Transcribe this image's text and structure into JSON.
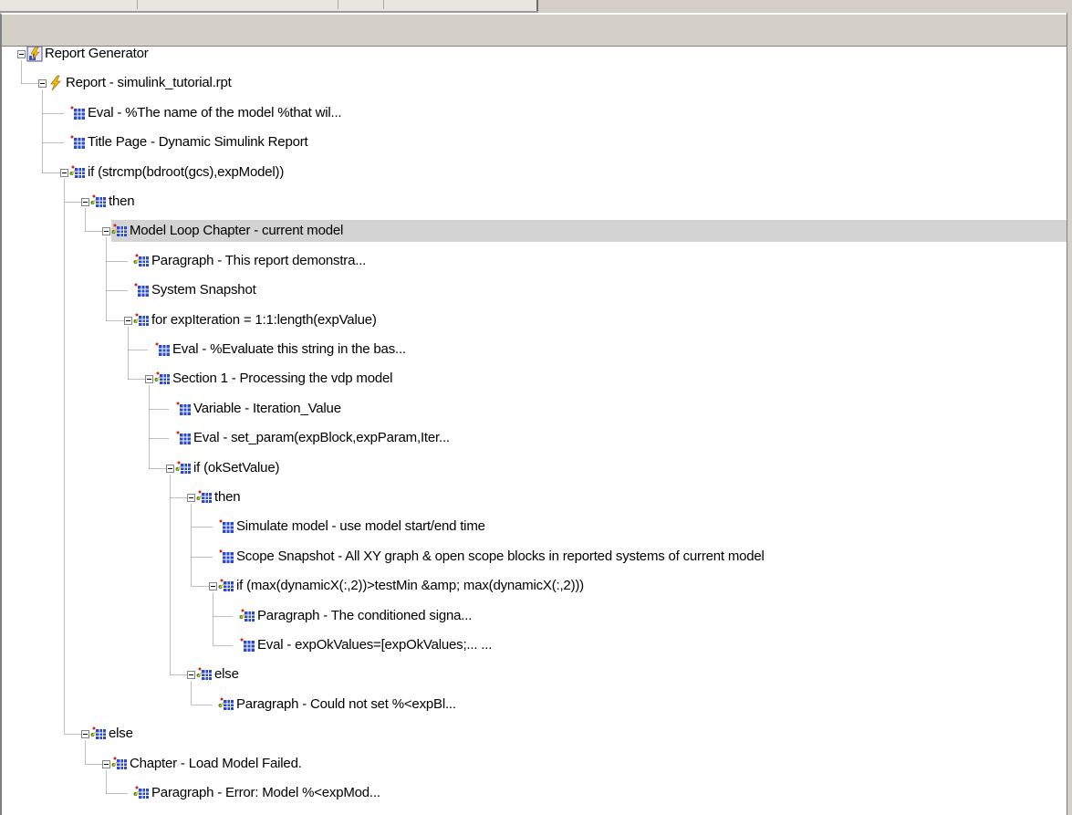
{
  "panel": {
    "header": ""
  },
  "colors": {
    "selection": "#d3d3d3",
    "tree_lines": "#808080",
    "panel_bg": "#d4d0c8"
  },
  "tree": {
    "nodes": [
      {
        "label": "Report Generator",
        "icon": "report-generator-icon",
        "depth": 0,
        "expanded": true
      },
      {
        "label": "Report - simulink_tutorial.rpt",
        "icon": "report-lightning-icon",
        "depth": 1,
        "expanded": true
      },
      {
        "label": "Eval - %The name of the model %that wil...",
        "icon": "component-table-icon",
        "depth": 2
      },
      {
        "label": "Title Page - Dynamic Simulink Report",
        "icon": "component-table-icon",
        "depth": 2
      },
      {
        "label": "if (strcmp(bdroot(gcs),expModel))",
        "icon": "logical-component-icon",
        "depth": 2,
        "expanded": true
      },
      {
        "label": "then",
        "icon": "logical-component-icon",
        "depth": 3,
        "expanded": true
      },
      {
        "label": "Model Loop Chapter - current model",
        "icon": "logical-component-icon",
        "depth": 4,
        "expanded": true,
        "selected": true
      },
      {
        "label": "Paragraph - This report demonstra...",
        "icon": "logical-component-icon",
        "depth": 5
      },
      {
        "label": "System Snapshot",
        "icon": "component-table-icon",
        "depth": 5
      },
      {
        "label": "for expIteration = 1:1:length(expValue)",
        "icon": "logical-component-icon",
        "depth": 5,
        "expanded": true
      },
      {
        "label": "Eval - %Evaluate this string in the bas...",
        "icon": "component-table-icon",
        "depth": 6
      },
      {
        "label": "Section 1 - Processing the vdp model",
        "icon": "logical-component-icon",
        "depth": 6,
        "expanded": true
      },
      {
        "label": "Variable - Iteration_Value",
        "icon": "component-table-icon",
        "depth": 7
      },
      {
        "label": "Eval - set_param(expBlock,expParam,Iter...",
        "icon": "component-table-icon",
        "depth": 7
      },
      {
        "label": "if (okSetValue)",
        "icon": "logical-component-icon",
        "depth": 7,
        "expanded": true
      },
      {
        "label": "then",
        "icon": "logical-component-icon",
        "depth": 8,
        "expanded": true
      },
      {
        "label": "Simulate model - use model start/end time",
        "icon": "component-table-icon",
        "depth": 9
      },
      {
        "label": "Scope Snapshot - All XY graph & open scope blocks in reported systems of current model",
        "icon": "component-table-icon",
        "depth": 9
      },
      {
        "label": "if (max(dynamicX(:,2))>testMin &amp; max(dynamicX(:,2)))",
        "icon": "logical-component-icon",
        "depth": 9,
        "expanded": true
      },
      {
        "label": "Paragraph - The conditioned signa...",
        "icon": "logical-component-icon",
        "depth": 10
      },
      {
        "label": "Eval - expOkValues=[expOkValues;...    ...",
        "icon": "component-table-icon",
        "depth": 10
      },
      {
        "label": "else",
        "icon": "logical-component-icon",
        "depth": 8,
        "expanded": true
      },
      {
        "label": "Paragraph - Could not set %<expBl...",
        "icon": "logical-component-icon",
        "depth": 9
      },
      {
        "label": "else",
        "icon": "logical-component-icon",
        "depth": 3,
        "expanded": true
      },
      {
        "label": "Chapter - Load Model Failed.",
        "icon": "logical-component-icon",
        "depth": 4,
        "expanded": true
      },
      {
        "label": "Paragraph - Error: Model %<expMod...",
        "icon": "logical-component-icon",
        "depth": 5
      }
    ]
  }
}
